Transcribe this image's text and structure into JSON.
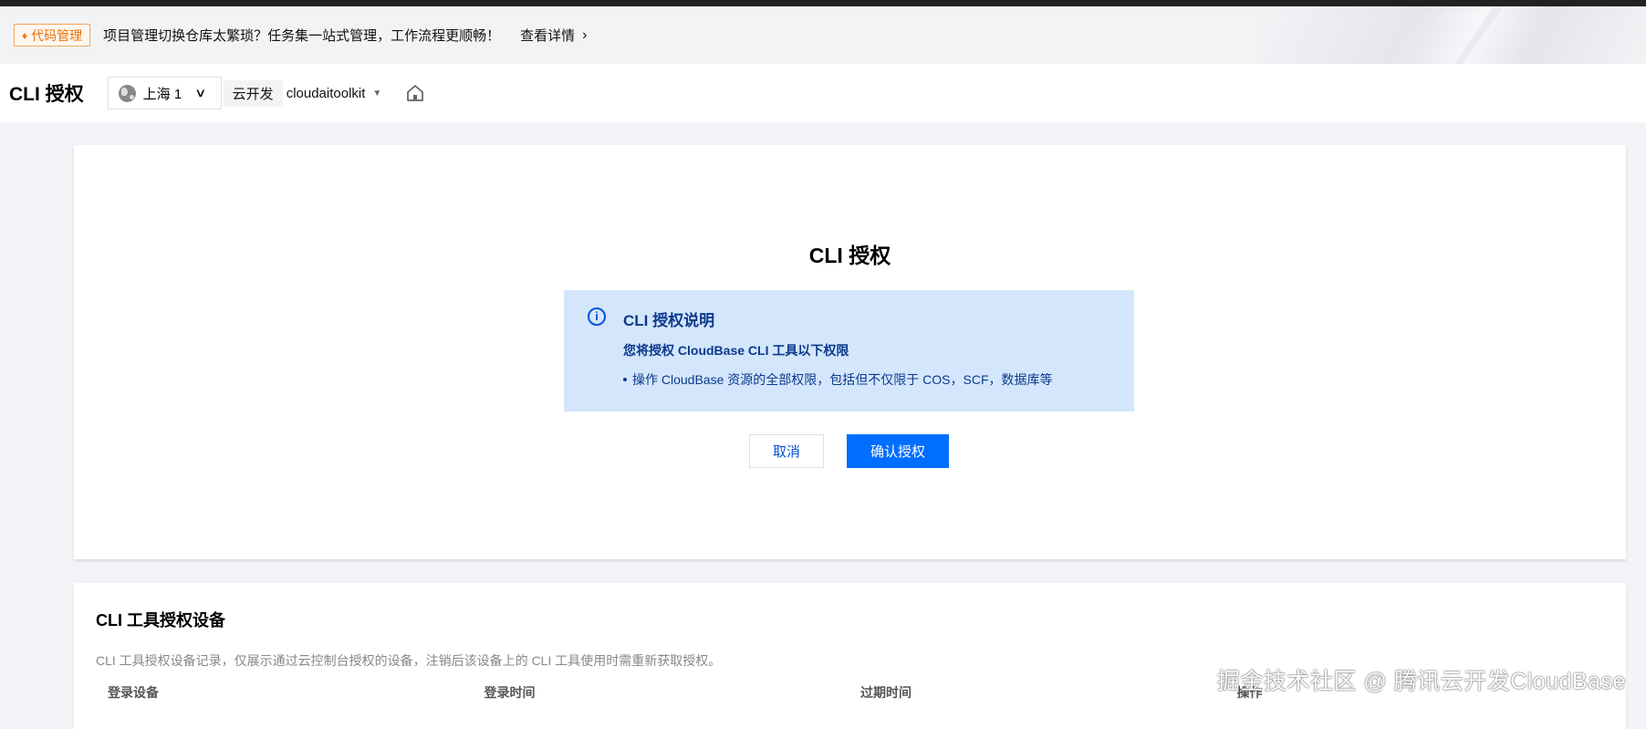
{
  "notice": {
    "tag": "代码管理",
    "text": "项目管理切换仓库太繁琐？任务集一站式管理，工作流程更顺畅！",
    "link": "查看详情"
  },
  "header": {
    "title": "CLI 授权",
    "region": "上海 1",
    "env_label": "云开发",
    "env_name": "cloudaitoolkit"
  },
  "auth": {
    "title": "CLI 授权",
    "info_title": "CLI 授权说明",
    "info_subtitle": "您将授权 CloudBase CLI 工具以下权限",
    "info_bullet": "操作 CloudBase 资源的全部权限，包括但不仅限于 COS，SCF，数据库等",
    "cancel_label": "取消",
    "confirm_label": "确认授权"
  },
  "devices": {
    "title": "CLI 工具授权设备",
    "description": "CLI 工具授权设备记录，仅展示通过云控制台授权的设备，注销后该设备上的 CLI 工具使用时需重新获取授权。",
    "columns": [
      "登录设备",
      "登录时间",
      "过期时间",
      "操作"
    ]
  },
  "watermark": "掘金技术社区 @ 腾讯云开发CloudBase",
  "colors": {
    "primary": "#006eff",
    "info_bg": "#d4e6fb",
    "info_text": "#0b3a8c",
    "tag_orange": "#e8730b"
  },
  "icons": [
    "flame-icon",
    "chevron-right-icon",
    "globe-icon",
    "chevron-down-icon",
    "caret-down-icon",
    "home-icon",
    "info-icon"
  ]
}
